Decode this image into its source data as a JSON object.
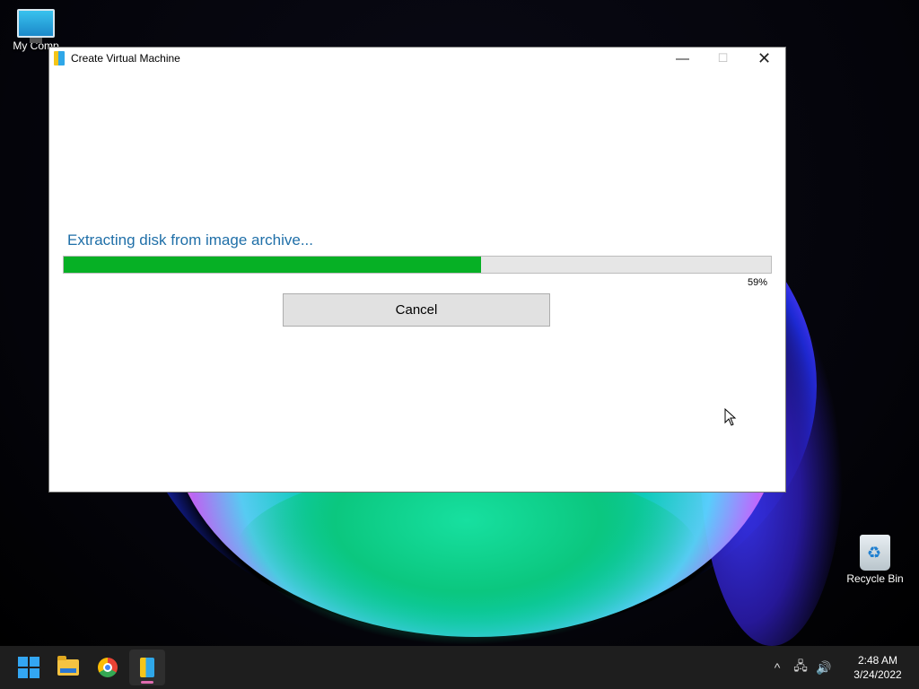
{
  "desktop": {
    "icons": [
      {
        "label": "My Comp"
      },
      {
        "label": "Recycle Bin"
      }
    ]
  },
  "window": {
    "title": "Create Virtual Machine",
    "controls": {
      "minimize": "—",
      "maximize": "☐",
      "close": "✕"
    },
    "status_text": "Extracting disk from image archive...",
    "progress": {
      "value_percent": 59,
      "label": "59%",
      "fill_color": "#06b025"
    },
    "cancel_label": "Cancel"
  },
  "taskbar": {
    "apps": [
      {
        "name": "start",
        "icon": "windows-logo-icon"
      },
      {
        "name": "file-explorer",
        "icon": "folder-icon"
      },
      {
        "name": "chrome",
        "icon": "chrome-icon"
      },
      {
        "name": "create-virtual-machine",
        "icon": "vm-app-icon",
        "active": true
      }
    ],
    "tray": {
      "chevron": "^",
      "network": "🖧",
      "volume": "🔊",
      "time": "2:48 AM",
      "date": "3/24/2022"
    }
  }
}
